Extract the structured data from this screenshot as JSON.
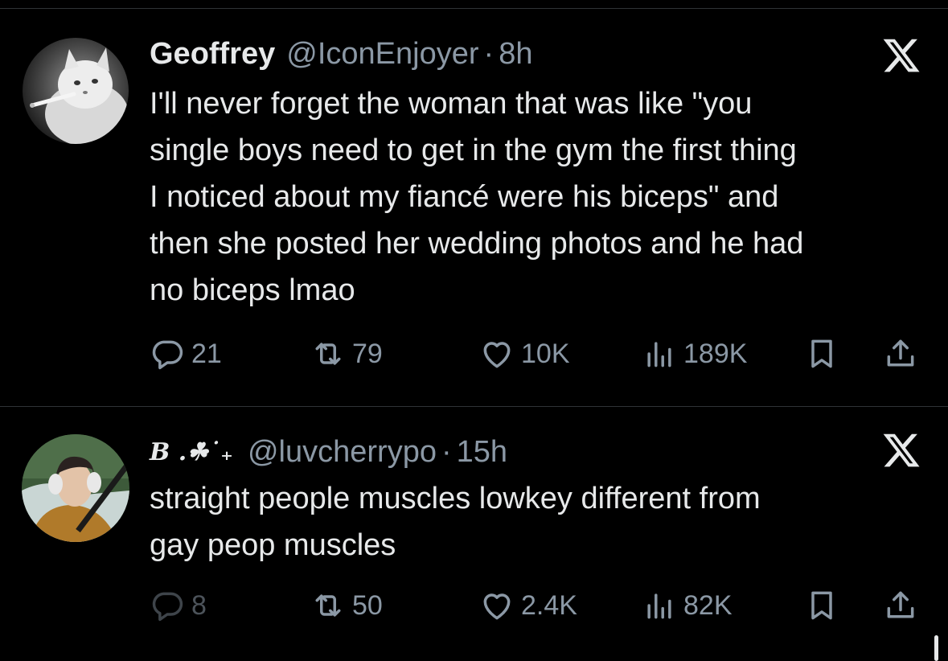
{
  "tweets": [
    {
      "display_name": "Geoffrey",
      "handle": "@IconEnjoyer",
      "separator": "·",
      "time": "8h",
      "text_lines": [
        "I'll never forget the woman that was like \"you",
        "single boys need to get in the gym the first thing",
        "I noticed about my fiancé were his biceps\" and",
        "then she posted her wedding photos and he had",
        "no biceps lmao"
      ],
      "replies": "21",
      "reposts": "79",
      "likes": "10K",
      "views": "189K",
      "avatar_icon": "cat-smoking-avatar"
    },
    {
      "display_name": "B .☘˙₊",
      "handle": "@luvcherrypo",
      "separator": "·",
      "time": "15h",
      "text_lines": [
        "straight people muscles lowkey different from",
        "gay peop muscles"
      ],
      "replies": "8",
      "reposts": "50",
      "likes": "2.4K",
      "views": "82K",
      "avatar_icon": "person-with-headphones-avatar"
    }
  ],
  "colors": {
    "background": "#000000",
    "text": "#e7e9ea",
    "muted": "#8b98a5",
    "divider": "#2f3336"
  }
}
